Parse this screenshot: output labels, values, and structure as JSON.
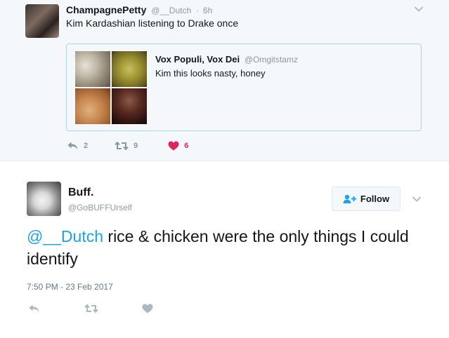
{
  "quoted_parent": {
    "author_name": "ChampagnePetty",
    "author_handle": "@__Dutch",
    "time_sep": "·",
    "time": "6h",
    "text": "Kim Kardashian listening to Drake once",
    "quote": {
      "author_name": "Vox Populi, Vox Dei",
      "author_handle": "@Omgitstamz",
      "text": "Kim this looks nasty, honey"
    },
    "actions": {
      "replies": "2",
      "retweets": "9",
      "likes": "6"
    }
  },
  "tweet": {
    "author_name": "Buff.",
    "author_handle": "@GoBUFFUrself",
    "follow_label": "Follow",
    "mention": "@__Dutch",
    "text": " rice & chicken were the only things I could identify",
    "timestamp": "7:50 PM - 23 Feb 2017"
  },
  "colors": {
    "like_active": "#e0245e",
    "link": "#1da1f2",
    "muted": "#8899a6",
    "quote_border": "#a4d9f3"
  },
  "icons": [
    "reply-icon",
    "retweet-icon",
    "heart-icon",
    "follow-user-icon",
    "chevron-down-icon"
  ]
}
